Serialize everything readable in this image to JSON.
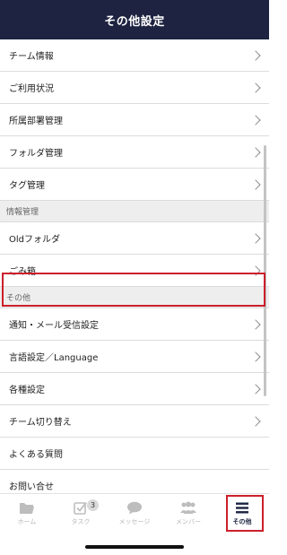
{
  "header": {
    "title": "その他設定"
  },
  "groups": {
    "main": [
      "チーム情報",
      "ご利用状況",
      "所属部署管理",
      "フォルダ管理",
      "タグ管理"
    ],
    "info_section": "情報管理",
    "info": [
      "Oldフォルダ",
      "ごみ箱"
    ],
    "other_section": "その他",
    "other": [
      "通知・メール受信設定",
      "言語設定／Language",
      "各種設定",
      "チーム切り替え",
      "よくある質問",
      "お問い合せ"
    ]
  },
  "tabbar": {
    "home": "ホーム",
    "task": "タスク",
    "task_badge": "3",
    "message": "メッセージ",
    "member": "メンバー",
    "other": "その他"
  },
  "colors": {
    "header_bg": "#1d2340",
    "highlight": "#cc1f2b",
    "section_bg": "#eeeeee"
  }
}
